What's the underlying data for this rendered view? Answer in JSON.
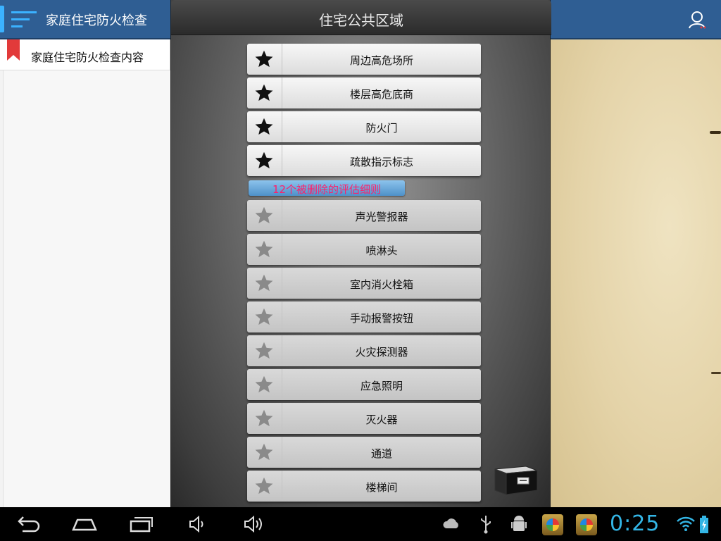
{
  "app_bar": {
    "title": "家庭住宅防火检查",
    "menu_icon": "menu-lines-icon",
    "user_icon": "user-account-icon"
  },
  "drawer": {
    "item_label": "家庭住宅防火检查内容"
  },
  "dialog": {
    "title": "住宅公共区域",
    "active_rules": [
      {
        "label": "周边高危场所"
      },
      {
        "label": "楼层高危底商"
      },
      {
        "label": "防火门"
      },
      {
        "label": "疏散指示标志"
      }
    ],
    "deleted_header": "12个被删除的评估细则",
    "deleted_rules": [
      {
        "label": "声光警报器"
      },
      {
        "label": "喷淋头"
      },
      {
        "label": "室内消火栓箱"
      },
      {
        "label": "手动报警按钮"
      },
      {
        "label": "火灾探测器"
      },
      {
        "label": "应急照明"
      },
      {
        "label": "灭火器"
      },
      {
        "label": "通道"
      },
      {
        "label": "楼梯间"
      }
    ]
  },
  "status_bar": {
    "clock": "0:25"
  },
  "colors": {
    "app_bar": "#2f5e93",
    "accent": "#33b5e5",
    "deleted_text": "#ff1f6a"
  }
}
